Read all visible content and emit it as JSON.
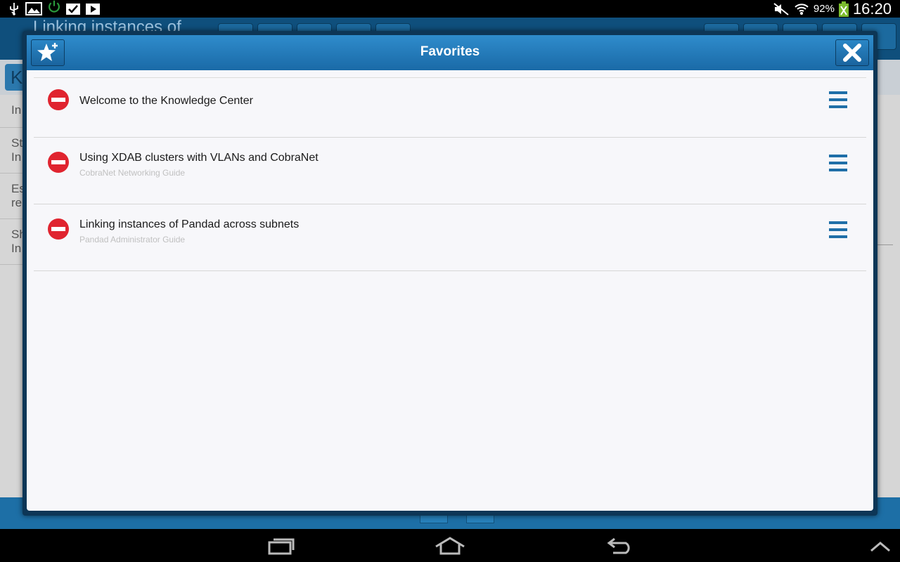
{
  "status_bar": {
    "battery": "92%",
    "time": "16:20",
    "icons": [
      "usb-icon",
      "image-icon",
      "power-icon",
      "clipboard-check-icon",
      "play-store-icon",
      "mute-icon",
      "wifi-icon",
      "battery-charging-icon"
    ]
  },
  "background_app": {
    "header_title": "Linking instances of",
    "sub_button_letter": "K",
    "list_items": [
      "In",
      "St\nIn",
      "Es\nre",
      "Sh\nIn"
    ]
  },
  "modal": {
    "title": "Favorites",
    "add_button_icon": "star-plus-icon",
    "close_button_icon": "close-icon",
    "favorites": [
      {
        "title": "Welcome to the Knowledge Center",
        "subtitle": ""
      },
      {
        "title": "Using XDAB clusters with VLANs and CobraNet",
        "subtitle": "CobraNet Networking Guide"
      },
      {
        "title": "Linking instances of Pandad across subnets",
        "subtitle": "Pandad Administrator Guide"
      }
    ]
  },
  "colors": {
    "header_blue": "#1a6aa7",
    "remove_red": "#e0242f",
    "handle_blue": "#1f6fa8"
  },
  "nav_bar": {
    "icons": [
      "recent-apps-icon",
      "home-icon",
      "back-icon",
      "chevron-up-icon"
    ]
  }
}
